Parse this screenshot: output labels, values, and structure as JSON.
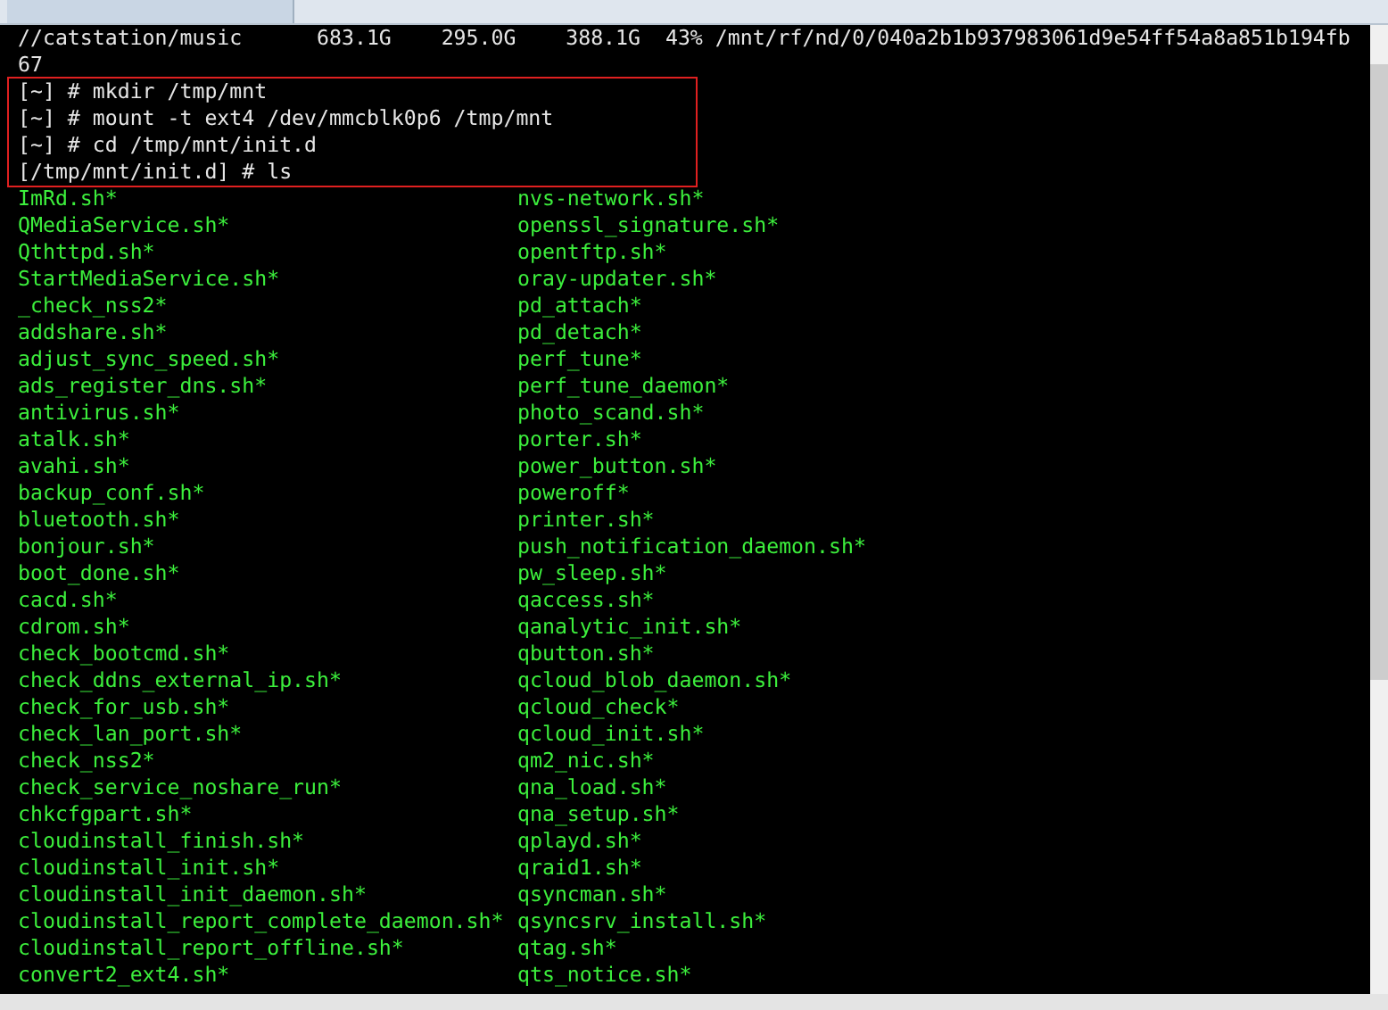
{
  "terminal": {
    "output_lines": [
      "//catstation/music      683.1G    295.0G    388.1G  43% /mnt/rf/nd/0/040a2b1b937983061d9e54ff54a8a851b194fb",
      "67"
    ],
    "highlighted_commands": [
      "[~] # mkdir /tmp/mnt",
      "[~] # mount -t ext4 /dev/mmcblk0p6 /tmp/mnt",
      "[~] # cd /tmp/mnt/init.d",
      "[/tmp/mnt/init.d] # ls"
    ],
    "listing_columns": [
      [
        "ImRd.sh*",
        "QMediaService.sh*",
        "Qthttpd.sh*",
        "StartMediaService.sh*",
        "_check_nss2*",
        "addshare.sh*",
        "adjust_sync_speed.sh*",
        "ads_register_dns.sh*",
        "antivirus.sh*",
        "atalk.sh*",
        "avahi.sh*",
        "backup_conf.sh*",
        "bluetooth.sh*",
        "bonjour.sh*",
        "boot_done.sh*",
        "cacd.sh*",
        "cdrom.sh*",
        "check_bootcmd.sh*",
        "check_ddns_external_ip.sh*",
        "check_for_usb.sh*",
        "check_lan_port.sh*",
        "check_nss2*",
        "check_service_noshare_run*",
        "chkcfgpart.sh*",
        "cloudinstall_finish.sh*",
        "cloudinstall_init.sh*",
        "cloudinstall_init_daemon.sh*",
        "cloudinstall_report_complete_daemon.sh*",
        "cloudinstall_report_offline.sh*",
        "convert2_ext4.sh*"
      ],
      [
        "nvs-network.sh*",
        "openssl_signature.sh*",
        "opentftp.sh*",
        "oray-updater.sh*",
        "pd_attach*",
        "pd_detach*",
        "perf_tune*",
        "perf_tune_daemon*",
        "photo_scand.sh*",
        "porter.sh*",
        "power_button.sh*",
        "poweroff*",
        "printer.sh*",
        "push_notification_daemon.sh*",
        "pw_sleep.sh*",
        "qaccess.sh*",
        "qanalytic_init.sh*",
        "qbutton.sh*",
        "qcloud_blob_daemon.sh*",
        "qcloud_check*",
        "qcloud_init.sh*",
        "qm2_nic.sh*",
        "qna_load.sh*",
        "qna_setup.sh*",
        "qplayd.sh*",
        "qraid1.sh*",
        "qsyncman.sh*",
        "qsyncsrv_install.sh*",
        "qtag.sh*",
        "qts_notice.sh*"
      ]
    ]
  }
}
